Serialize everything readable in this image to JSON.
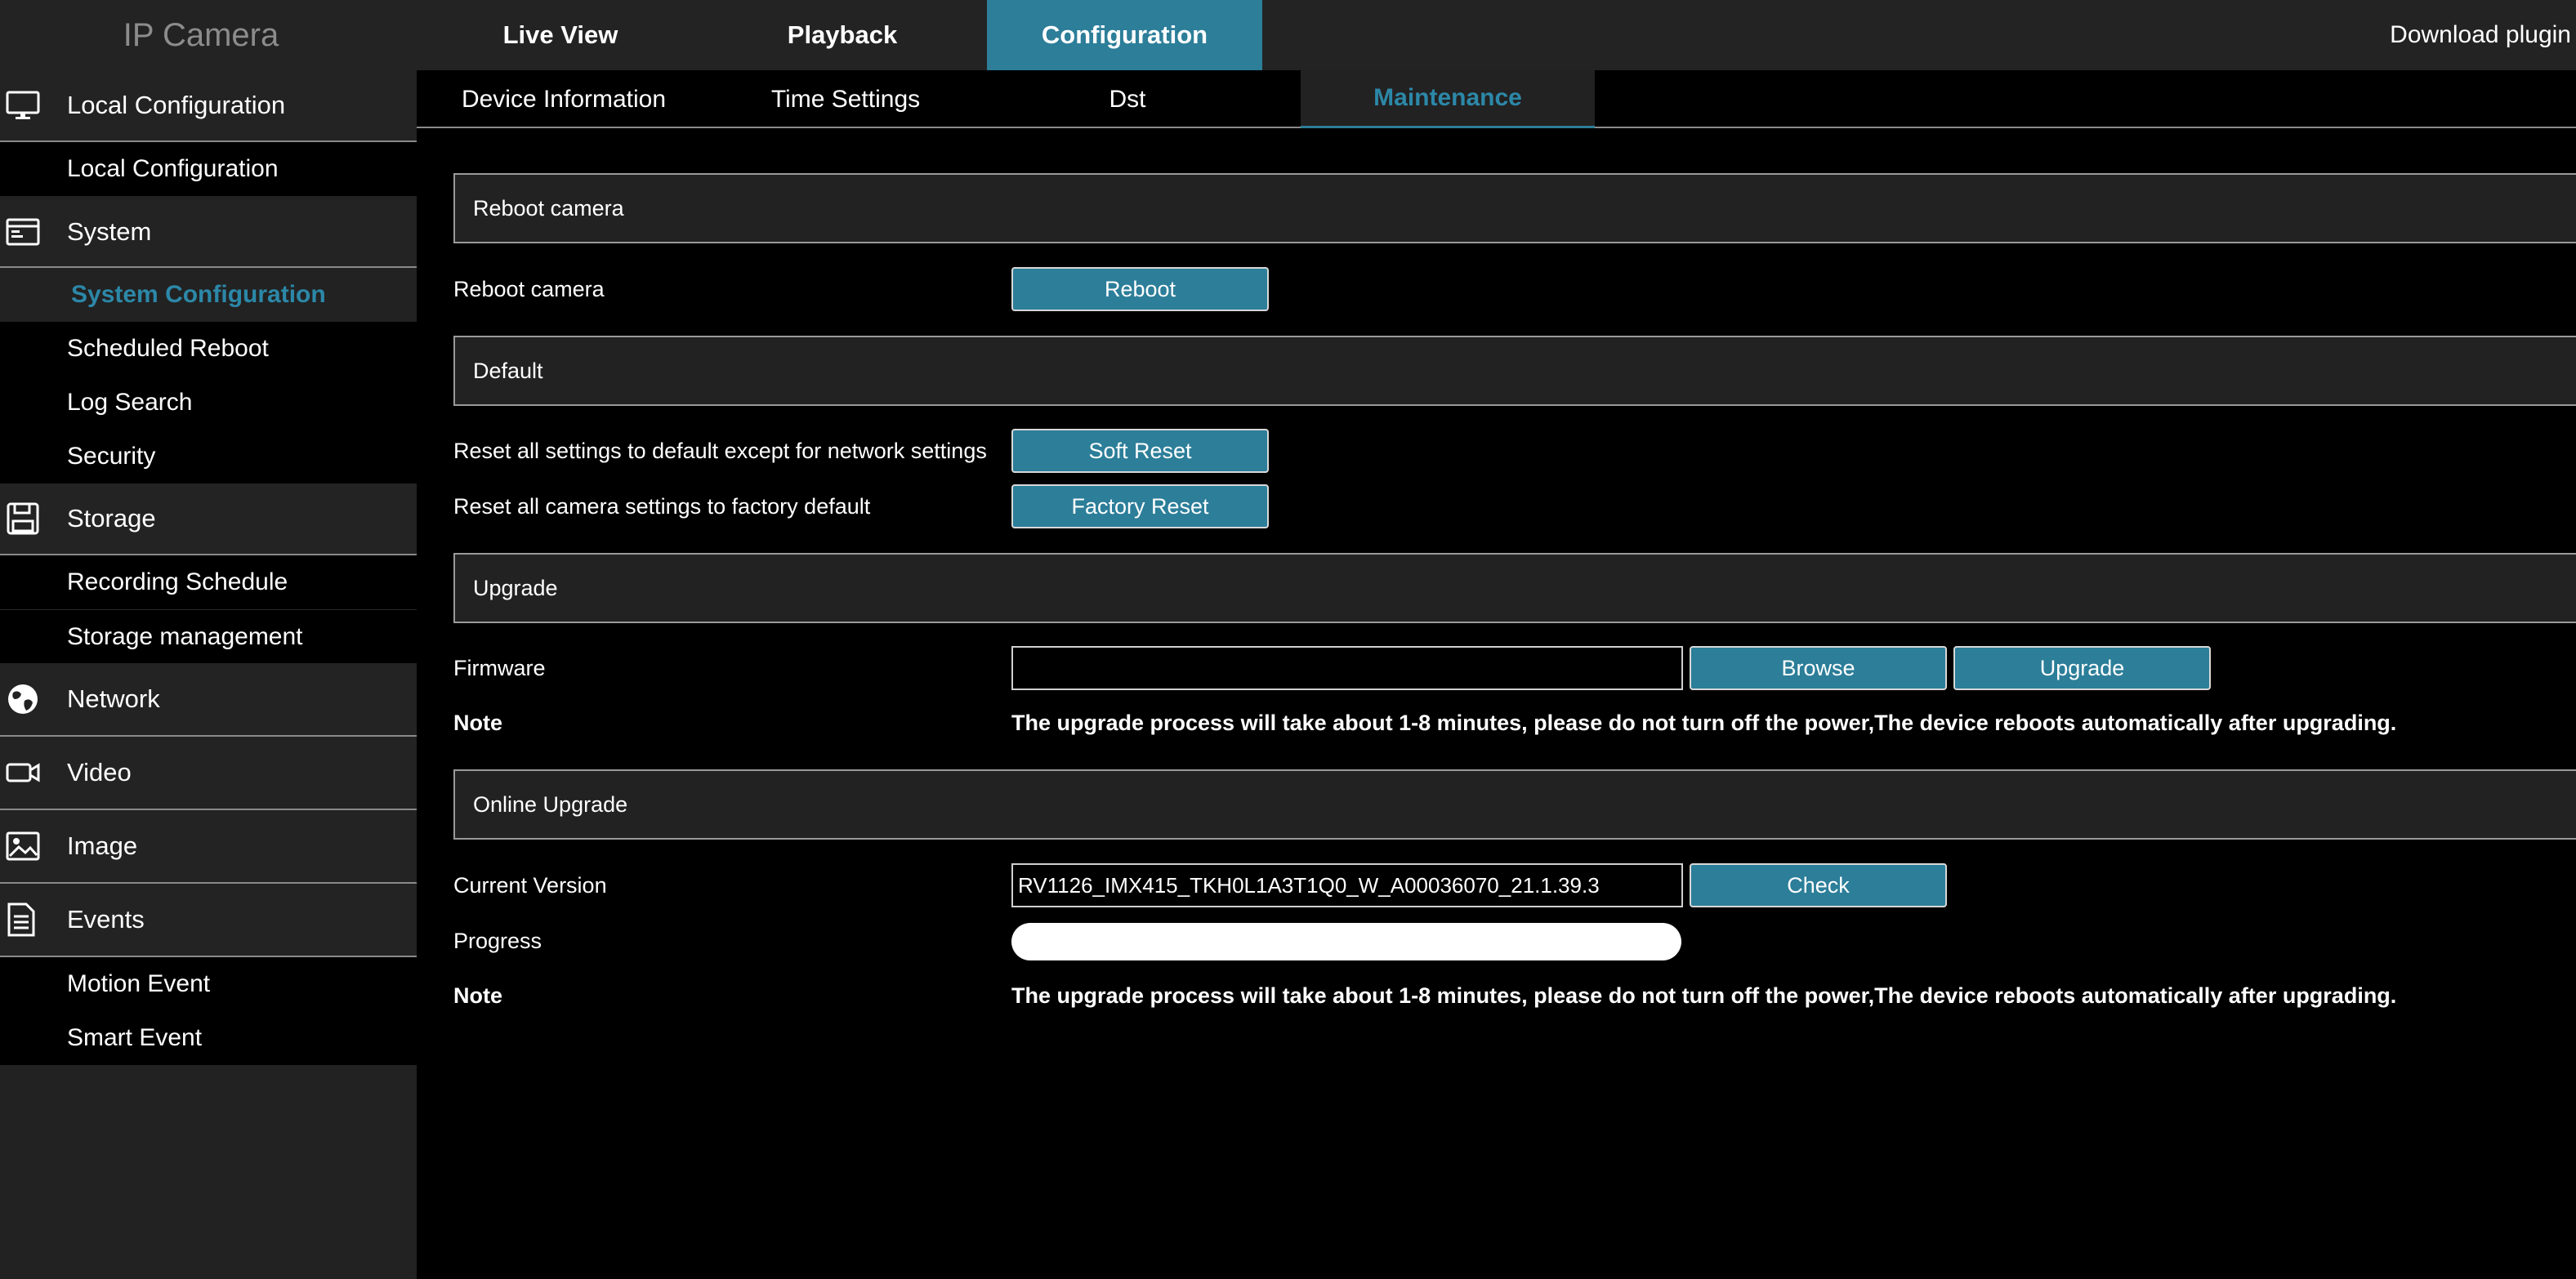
{
  "header": {
    "brand": "IP Camera",
    "nav": [
      "Live View",
      "Playback",
      "Configuration"
    ],
    "active_nav": "Configuration",
    "download_plugin": "Download plugin"
  },
  "sidebar": {
    "groups": [
      {
        "label": "Local Configuration",
        "icon": "monitor-icon",
        "items": [
          "Local Configuration"
        ]
      },
      {
        "label": "System",
        "icon": "system-window-icon",
        "items": [
          "System Configuration",
          "Scheduled Reboot",
          "Log Search",
          "Security"
        ]
      },
      {
        "label": "Storage",
        "icon": "floppy-disk-icon",
        "items": [
          "Recording Schedule",
          "Storage management"
        ]
      },
      {
        "label": "Network",
        "icon": "globe-icon",
        "items": []
      },
      {
        "label": "Video",
        "icon": "video-camera-icon",
        "items": []
      },
      {
        "label": "Image",
        "icon": "image-icon",
        "items": []
      },
      {
        "label": "Events",
        "icon": "document-icon",
        "items": [
          "Motion Event",
          "Smart Event"
        ]
      }
    ],
    "active_item": "System Configuration"
  },
  "subtabs": {
    "items": [
      "Device Information",
      "Time Settings",
      "Dst",
      "Maintenance"
    ],
    "active": "Maintenance"
  },
  "reboot": {
    "section_title": "Reboot camera",
    "label": "Reboot camera",
    "button": "Reboot"
  },
  "default": {
    "section_title": "Default",
    "soft_label": "Reset all settings to default except for network settings",
    "soft_button": "Soft Reset",
    "factory_label": "Reset all camera settings to factory default",
    "factory_button": "Factory Reset"
  },
  "upgrade": {
    "section_title": "Upgrade",
    "firmware_label": "Firmware",
    "firmware_value": "",
    "browse_button": "Browse",
    "upgrade_button": "Upgrade",
    "note_label": "Note",
    "note_text": "The upgrade process will take about 1-8 minutes, please do not turn off the power,The device reboots automatically after upgrading."
  },
  "online_upgrade": {
    "section_title": "Online Upgrade",
    "version_label": "Current Version",
    "version_value": "RV1126_IMX415_TKH0L1A3T1Q0_W_A00036070_21.1.39.3",
    "check_button": "Check",
    "progress_label": "Progress",
    "progress_percent": 0,
    "note_label": "Note",
    "note_text": "The upgrade process will take about 1-8 minutes, please do not turn off the power,The device reboots automatically after upgrading."
  },
  "colors": {
    "accent": "#2c7e99",
    "accent_text": "#2c88a8",
    "panel": "#222222"
  }
}
